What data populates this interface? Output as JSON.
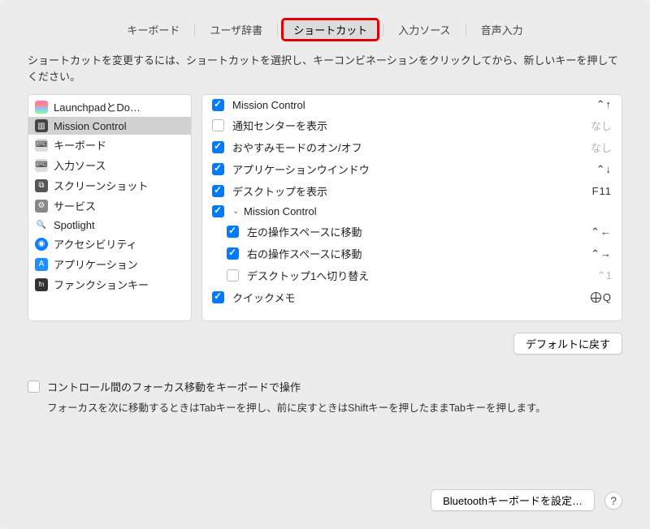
{
  "tabs": {
    "keyboard": "キーボード",
    "userdict": "ユーザ辞書",
    "shortcuts": "ショートカット",
    "input_sources": "入力ソース",
    "dictation": "音声入力"
  },
  "instructions": "ショートカットを変更するには、ショートカットを選択し、キーコンビネーションをクリックしてから、新しいキーを押してください。",
  "sidebar": {
    "items": [
      {
        "label": "LaunchpadとDo…"
      },
      {
        "label": "Mission Control"
      },
      {
        "label": "キーボード"
      },
      {
        "label": "入力ソース"
      },
      {
        "label": "スクリーンショット"
      },
      {
        "label": "サービス"
      },
      {
        "label": "Spotlight"
      },
      {
        "label": "アクセシビリティ"
      },
      {
        "label": "アプリケーション"
      },
      {
        "label": "ファンクションキー"
      }
    ]
  },
  "shortcuts": [
    {
      "label": "Mission Control",
      "key": "⌃↑",
      "checked": true,
      "indent": 0
    },
    {
      "label": "通知センターを表示",
      "key": "なし",
      "checked": false,
      "indent": 0,
      "dim": true
    },
    {
      "label": "おやすみモードのオン/オフ",
      "key": "なし",
      "checked": true,
      "indent": 0,
      "dim": true
    },
    {
      "label": "アプリケーションウインドウ",
      "key": "⌃↓",
      "checked": true,
      "indent": 0
    },
    {
      "label": "デスクトップを表示",
      "key": "F11",
      "checked": true,
      "indent": 0
    },
    {
      "label": "Mission Control",
      "key": "",
      "checked": true,
      "indent": 0,
      "group": true
    },
    {
      "label": "左の操作スペースに移動",
      "key": "⌃←",
      "checked": true,
      "indent": 1
    },
    {
      "label": "右の操作スペースに移動",
      "key": "⌃→",
      "checked": true,
      "indent": 1
    },
    {
      "label": "デスクトップ1へ切り替え",
      "key": "⌃1",
      "checked": false,
      "indent": 1,
      "dim": true
    },
    {
      "label": "クイックメモ",
      "key": "globeQ",
      "checked": true,
      "indent": 0
    }
  ],
  "restore_defaults": "デフォルトに戻す",
  "focus": {
    "label": "コントロール間のフォーカス移動をキーボードで操作",
    "help": "フォーカスを次に移動するときはTabキーを押し、前に戻すときはShiftキーを押したままTabキーを押します。"
  },
  "bluetooth_btn": "Bluetoothキーボードを設定…",
  "help": "?"
}
